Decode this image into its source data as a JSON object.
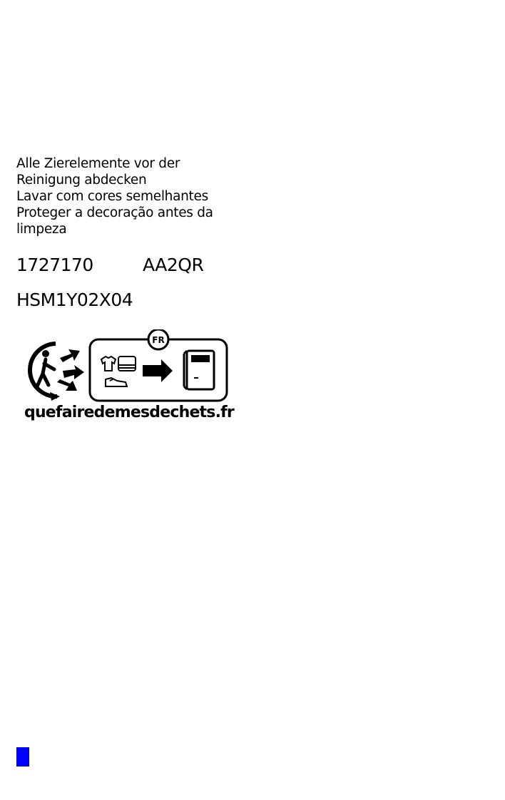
{
  "care_instructions": [
    "Alle Zierelemente vor der",
    "Reinigung abdecken",
    "Lavar com cores semelhantes",
    "Proteger a decoração antes da",
    "limpeza"
  ],
  "codes": {
    "article_number": "1727170",
    "variant_code": "AA2QR"
  },
  "model_code": "HSM1Y02X04",
  "recycling_logo": {
    "country_badge": "FR",
    "website": "quefairedemesdechets.fr",
    "icons": [
      "triman-icon",
      "tshirt-icon",
      "folded-linen-icon",
      "shoe-icon",
      "arrow-right-icon",
      "collection-bin-icon"
    ]
  },
  "colors": {
    "marker": "#0000ff",
    "text": "#000000"
  }
}
